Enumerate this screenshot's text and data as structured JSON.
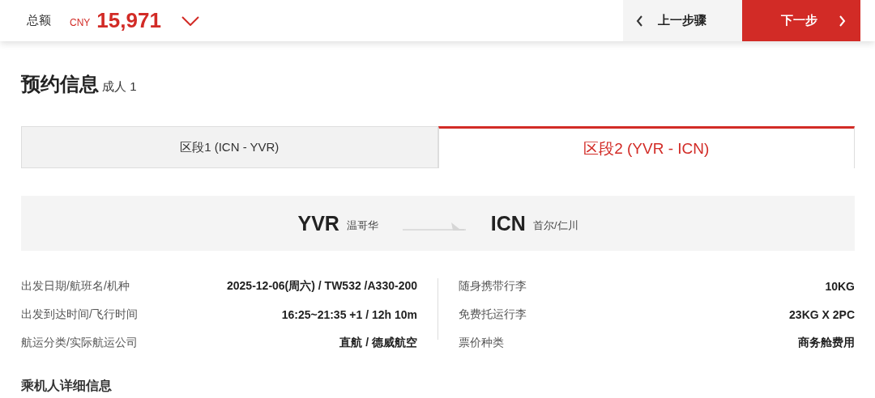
{
  "header": {
    "total_label": "总额",
    "currency": "CNY",
    "amount": "15,971",
    "prev_button": "上一步骤",
    "next_button": "下一步"
  },
  "booking": {
    "title": "预约信息",
    "passengers": "成人 1"
  },
  "tabs": [
    {
      "label": "区段1 (ICN - YVR)",
      "selected": false
    },
    {
      "label": "区段2 (YVR - ICN)",
      "selected": true
    }
  ],
  "route": {
    "from_code": "YVR",
    "from_city": "温哥华",
    "to_code": "ICN",
    "to_city": "首尔/仁川"
  },
  "details_left": [
    {
      "label": "出发日期/航班名/机种",
      "value": "2025-12-06(周六) / TW532 /A330-200"
    },
    {
      "label": "出发到达时间/飞行时间",
      "value": "16:25~21:35 +1 / 12h 10m"
    },
    {
      "label": "航运分类/实际航运公司",
      "value": "直航 / 德威航空"
    }
  ],
  "details_right": [
    {
      "label": "随身携带行李",
      "value": "10KG"
    },
    {
      "label": "免费托运行李",
      "value": "23KG X 2PC"
    },
    {
      "label": "票价种类",
      "value": "商务舱费用"
    }
  ],
  "section_title": "乘机人详细信息"
}
